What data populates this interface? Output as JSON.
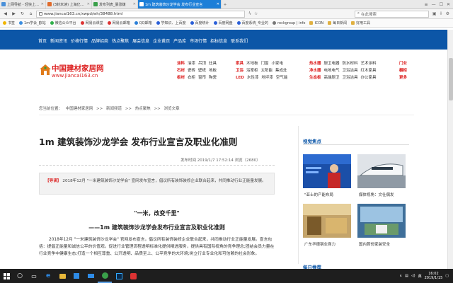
{
  "browser": {
    "tabs": [
      {
        "label": "上网导航 - 轻快上网 从这里开始"
      },
      {
        "label": "(3封未读) 上海亿米建筑工程服务有限"
      },
      {
        "label": "发布列表_暴涨嫌"
      },
      {
        "label": "1m 建筑装饰沙龙学会 发布行业宣言"
      }
    ],
    "address": "www.jiancai163.cn/xwpd/wh/38488.html",
    "search_placeholder": "在此搜索",
    "bookmarks": [
      "书签",
      "1m学会_欧站",
      "微信公众平台",
      "网易云课堂",
      "网易云邮箱",
      "QQ邮箱",
      "学知识、上百度",
      "百度统计",
      "百度网盘",
      "百度系统_专业的",
      "rockgroup | info",
      "ICON",
      "每日新闻",
      "好用工具"
    ]
  },
  "site": {
    "nav": [
      "首页",
      "新闻资讯",
      "价格行情",
      "品牌招商",
      "热点聚焦",
      "展会信息",
      "企业黄页",
      "产品库",
      "市场行情",
      "招标信息",
      "联系我们"
    ],
    "logo_cn": "中国建材家居网",
    "logo_en": "www.jiancai163.cn",
    "categories": [
      {
        "head": "涂料",
        "items": [
          "油漆",
          "吊顶",
          "灶具"
        ]
      },
      {
        "head": "石材",
        "items": [
          "瓷砖",
          "壁纸",
          "地板"
        ]
      },
      {
        "head": "板材",
        "items": [
          "衣柜",
          "窗帘",
          "陶瓷"
        ]
      },
      {
        "head": "家具",
        "items": [
          "木地板",
          "门窗",
          "小家电"
        ]
      },
      {
        "head": "卫浴",
        "items": [
          "浴室柜",
          "太阳能",
          "集成灶"
        ]
      },
      {
        "head": "LED",
        "items": [
          "水性漆",
          "地坪漆",
          "空气能"
        ]
      },
      {
        "head": "热水器",
        "items": [
          "厨卫电器",
          "防水材料",
          "艺术涂料"
        ]
      },
      {
        "head": "净水器",
        "items": [
          "电地电气",
          "卫浴洁具",
          "红木家具"
        ]
      },
      {
        "head": "生态板",
        "items": [
          "高端厨卫",
          "卫浴洁具",
          "办公家具"
        ]
      },
      {
        "head": "门业",
        "items": []
      },
      {
        "head": "橱柜",
        "items": []
      },
      {
        "head": "更多",
        "items": []
      }
    ]
  },
  "breadcrumb": {
    "prefix": "您当前位置：",
    "items": [
      "中国建材家居网",
      ">>",
      "新闻频道",
      ">>",
      "热点聚焦",
      ">>",
      "浏览文章"
    ]
  },
  "article": {
    "title": "1m 建筑装饰沙龙学会 发布行业宣言及职业化准则",
    "meta": "发布时间 2019/1/7 17:52:14  浏览（2680）",
    "summary_tag": "【导读】",
    "summary": "2018年12月 \"一米建筑装饰沙龙学会\" 宣网发布宣言，倡议所有装饰装修企业联合起来，共同推动行业正能量发展。",
    "subtitle1": "\"一米，改变千里\"",
    "subtitle2": "——1m 建筑装饰沙龙学会发布行业宣言及职业化准则",
    "body": "2018年12月 \"一米建筑装饰沙龙学会\" 官网发布宣言，倡议所有装饰装修企业联合起来，共同推动行业正能量发展。宣言包括：提倡正能量和诚信公平的价值观，促进行业管理流程透明标准化提供精进服务，提供具有国际视角的竞争理念;团结会员力量在行业竞争中健康生态;打造一个相互尊重、公开透明、品质至上、公平竞争的大环境;树立行业专业化和可信赖的社会形象。"
  },
  "sidebar": {
    "heading": "视觉焦点",
    "cards": [
      {
        "caption": "\"亚士的产能布局"
      },
      {
        "caption": "媒体视角：文仕偶发"
      },
      {
        "caption": "广东华德钢业商力"
      },
      {
        "caption": "国内首份家装安全"
      }
    ],
    "heading2": "每日推荐"
  },
  "taskbar": {
    "time": "16:02",
    "date": "2019/1/15",
    "lang": "英"
  }
}
